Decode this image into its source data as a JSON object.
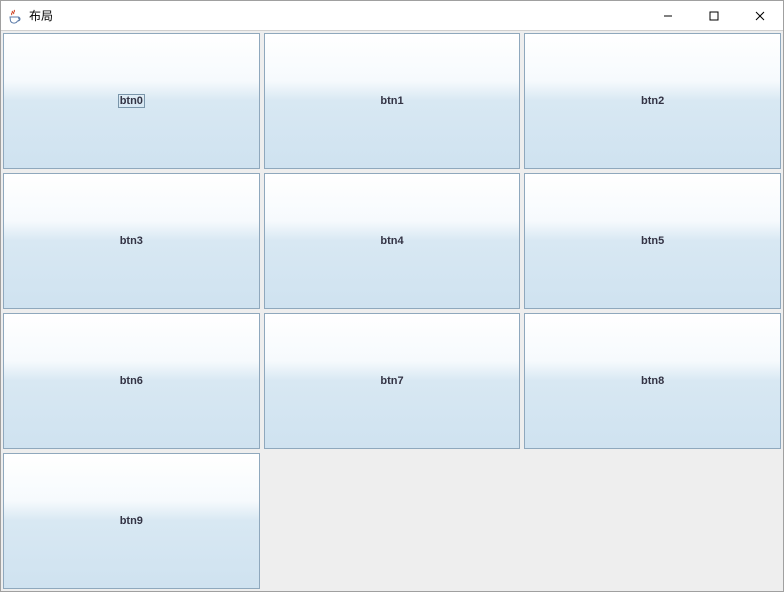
{
  "window": {
    "title": "布局"
  },
  "buttons": {
    "b0": "btn0",
    "b1": "btn1",
    "b2": "btn2",
    "b3": "btn3",
    "b4": "btn4",
    "b5": "btn5",
    "b6": "btn6",
    "b7": "btn7",
    "b8": "btn8",
    "b9": "btn9"
  }
}
